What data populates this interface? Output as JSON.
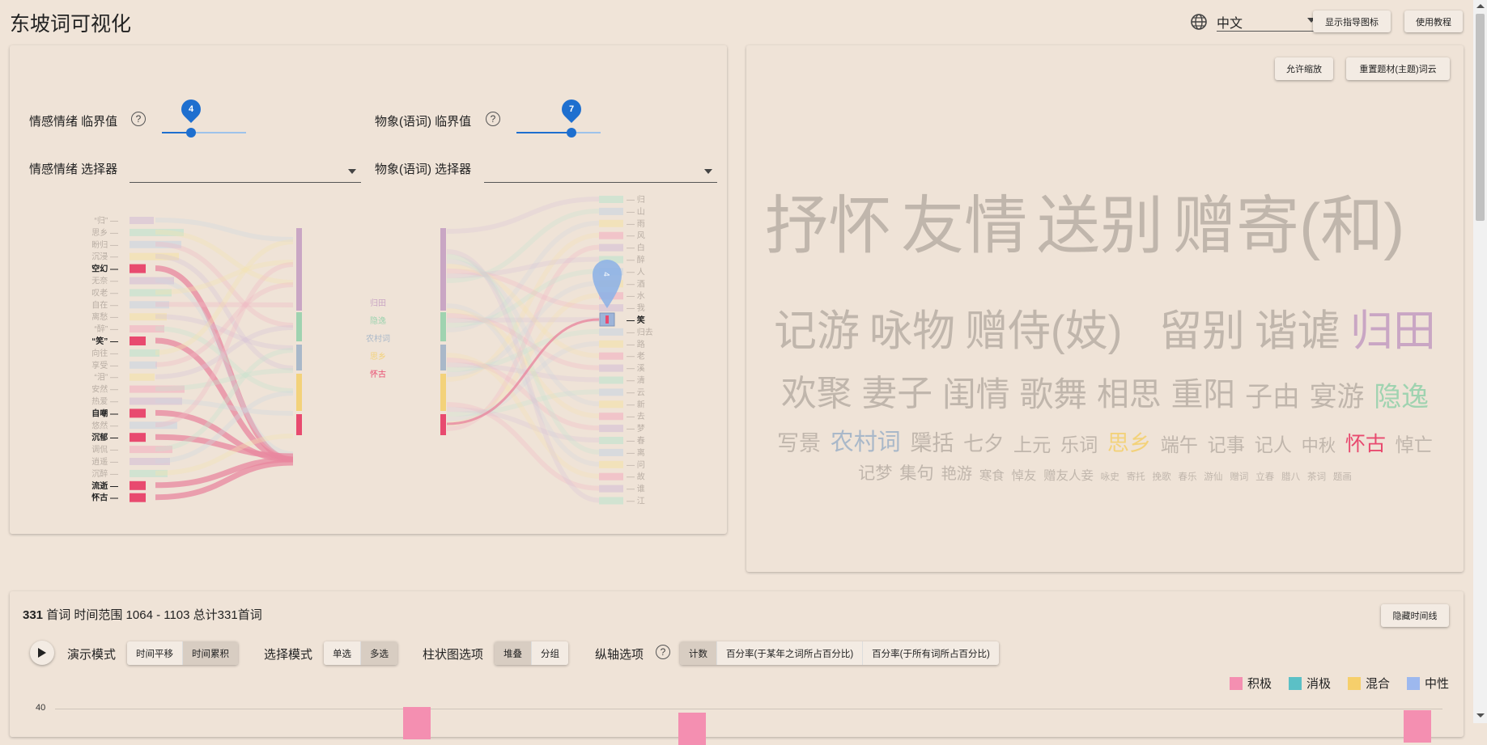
{
  "app": {
    "title": "东坡词可视化",
    "language": "中文",
    "show_guide_button": "显示指导图标",
    "tutorial_button": "使用教程"
  },
  "left_panel": {
    "emotion_threshold_label": "情感情绪 临界值",
    "emotion_threshold_value": "4",
    "emotion_threshold_fraction": 0.35,
    "imagery_threshold_label": "物象(语词) 临界值",
    "imagery_threshold_value": "7",
    "imagery_threshold_fraction": 0.65,
    "emotion_selector_label": "情感情绪 选择器",
    "imagery_selector_label": "物象(语词) 选择器",
    "left_sankey_labels": [
      "“归”",
      "思乡",
      "盼归",
      "沉浸",
      "空幻",
      "无奈",
      "叹老",
      "自在",
      "离愁",
      "“醉”",
      "“笑”",
      "向往",
      "享受",
      "“泪”",
      "安然",
      "热爱",
      "自嘲",
      "悠然",
      "沉郁",
      "调侃",
      "逍遥",
      "沉醉",
      "流逝",
      "怀古"
    ],
    "left_sankey_highlight": [
      "空幻",
      "“笑”",
      "自嘲",
      "沉郁",
      "流逝",
      "怀古"
    ],
    "theme_labels": [
      "归田",
      "隐逸",
      "农村词",
      "思乡",
      "怀古"
    ],
    "theme_colors": [
      "#c9a6c4",
      "#9fd3b0",
      "#a9b8c9",
      "#f3d27a",
      "#e84a6f"
    ],
    "right_sankey_labels": [
      "归",
      "山",
      "雨",
      "风",
      "白",
      "醉",
      "人",
      "酒",
      "水",
      "我",
      "笑",
      "归去",
      "路",
      "老",
      "溪",
      "清",
      "云",
      "新",
      "去",
      "梦",
      "春",
      "离",
      "问",
      "故",
      "谁",
      "江"
    ],
    "right_sankey_highlight": [
      "笑"
    ],
    "marker_value": "4"
  },
  "word_cloud": {
    "allow_zoom_button": "允许缩放",
    "reset_button": "重置题材(主题)词云",
    "rows": [
      [
        {
          "t": "抒怀",
          "c": "#c0b6ac"
        },
        {
          "t": "友情",
          "c": "#c0b6ac"
        },
        {
          "t": "送别",
          "c": "#c0b6ac"
        },
        {
          "t": "赠寄(和)",
          "c": "#c0b6ac"
        }
      ],
      [
        {
          "t": "记游",
          "c": "#c0b6ac"
        },
        {
          "t": "咏物",
          "c": "#c0b6ac"
        },
        {
          "t": "赠侍(妓)",
          "c": "#c0b6ac"
        },
        {
          "t": "留别",
          "c": "#c0b6ac"
        },
        {
          "t": "谐谑",
          "c": "#c0b6ac"
        },
        {
          "t": "归田",
          "c": "#c9a6c4"
        }
      ],
      [
        {
          "t": "欢聚",
          "c": "#c0b6ac"
        },
        {
          "t": "妻子",
          "c": "#c0b6ac"
        },
        {
          "t": "闺情",
          "c": "#c0b6ac"
        },
        {
          "t": "歌舞",
          "c": "#c0b6ac"
        },
        {
          "t": "相思",
          "c": "#c0b6ac"
        },
        {
          "t": "重阳",
          "c": "#c0b6ac"
        },
        {
          "t": "子由",
          "c": "#c0b6ac"
        },
        {
          "t": "宴游",
          "c": "#c0b6ac"
        },
        {
          "t": "隐逸",
          "c": "#9fd3b0"
        }
      ],
      [
        {
          "t": "写景",
          "c": "#c0b6ac"
        },
        {
          "t": "农村词",
          "c": "#a9b8c9"
        },
        {
          "t": "檃括",
          "c": "#c0b6ac"
        },
        {
          "t": "七夕",
          "c": "#c0b6ac"
        },
        {
          "t": "上元",
          "c": "#c0b6ac"
        },
        {
          "t": "乐词",
          "c": "#c0b6ac"
        },
        {
          "t": "思乡",
          "c": "#f3d27a"
        },
        {
          "t": "端午",
          "c": "#c0b6ac"
        },
        {
          "t": "记事",
          "c": "#c0b6ac"
        },
        {
          "t": "记人",
          "c": "#c0b6ac"
        },
        {
          "t": "中秋",
          "c": "#c0b6ac"
        },
        {
          "t": "怀古",
          "c": "#e84a6f"
        },
        {
          "t": "悼亡",
          "c": "#c0b6ac"
        }
      ],
      [
        {
          "t": "记梦",
          "c": "#c0b6ac"
        },
        {
          "t": "集句",
          "c": "#c0b6ac"
        },
        {
          "t": "艳游",
          "c": "#c0b6ac"
        },
        {
          "t": "寒食",
          "c": "#c0b6ac"
        },
        {
          "t": "悼友",
          "c": "#c0b6ac"
        },
        {
          "t": "赠友人妾",
          "c": "#c0b6ac"
        },
        {
          "t": "咏史",
          "c": "#c0b6ac"
        },
        {
          "t": "寄托",
          "c": "#c0b6ac"
        },
        {
          "t": "挽歌",
          "c": "#c0b6ac"
        },
        {
          "t": "春乐",
          "c": "#c0b6ac"
        },
        {
          "t": "游仙",
          "c": "#c0b6ac"
        },
        {
          "t": "赠词",
          "c": "#c0b6ac"
        },
        {
          "t": "立春",
          "c": "#c0b6ac"
        },
        {
          "t": "腊八",
          "c": "#c0b6ac"
        },
        {
          "t": "茶词",
          "c": "#c0b6ac"
        },
        {
          "t": "题画",
          "c": "#c0b6ac"
        }
      ]
    ]
  },
  "timeline": {
    "count": "331",
    "summary": "首词 时间范围 1064 - 1103 总计331首词",
    "hide_button": "隐藏时间线",
    "demo_mode_label": "演示模式",
    "demo_modes": [
      "时间平移",
      "时间累积"
    ],
    "select_mode_label": "选择模式",
    "select_modes": [
      "单选",
      "多选"
    ],
    "bar_option_label": "柱状图选项",
    "bar_options": [
      "堆叠",
      "分组"
    ],
    "y_option_label": "纵轴选项",
    "y_options": [
      "计数",
      "百分率(于某年之词所占百分比)",
      "百分率(于所有词所占百分比)"
    ],
    "legend": [
      {
        "label": "积极",
        "color": "#f48fb1"
      },
      {
        "label": "消极",
        "color": "#5bc0c6"
      },
      {
        "label": "混合",
        "color": "#f6cf6b"
      },
      {
        "label": "中性",
        "color": "#9db8ee"
      }
    ],
    "y_tick": "40",
    "bar_color": "#f48fb1"
  }
}
